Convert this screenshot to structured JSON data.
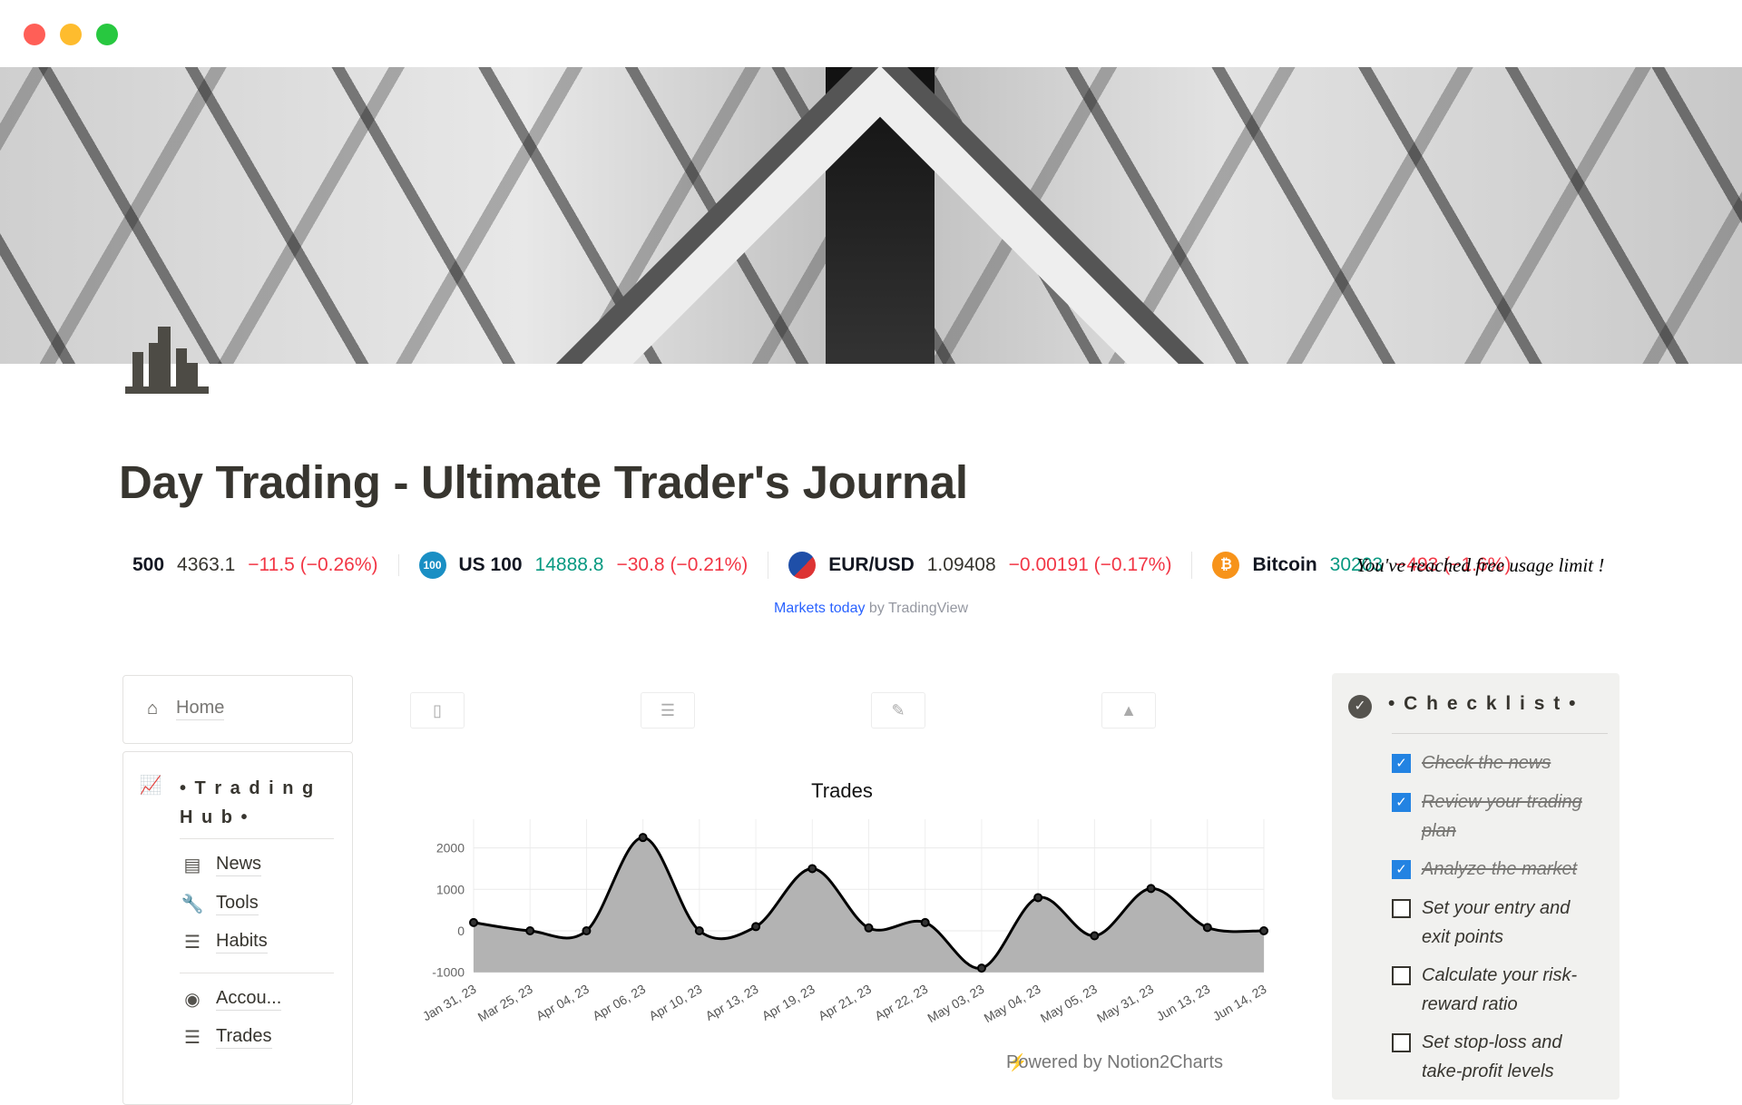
{
  "window": {
    "controls": {
      "close": "#ff5f57",
      "minimize": "#febc2e",
      "maximize": "#28c840"
    }
  },
  "page": {
    "title": "Day Trading - Ultimate Trader's Journal",
    "icon": "bar-chart-icon"
  },
  "ticker": {
    "items": [
      {
        "name": "500",
        "price": "4363.1",
        "change": "−11.5 (−0.26%)",
        "price_color": "#131722",
        "change_color": "#f23645"
      },
      {
        "name": "US 100",
        "icon_text": "100",
        "price": "14888.8",
        "change": "−30.8 (−0.21%)",
        "price_color": "#089981",
        "change_color": "#f23645"
      },
      {
        "name": "EUR/USD",
        "price": "1.09408",
        "change": "−0.00191 (−0.17%)",
        "price_color": "#131722",
        "change_color": "#f23645"
      },
      {
        "name": "Bitcoin",
        "icon_text": "₿",
        "price": "30203",
        "change": "−493 (−1.6%)",
        "price_color": "#089981",
        "change_color": "#f23645"
      }
    ],
    "limit_message": "You've reached free usage limit !",
    "credit_link": "Markets today",
    "credit_suffix": " by TradingView"
  },
  "sidebar": {
    "home": "Home",
    "hub_title": "• T r a d i n g  H u b •",
    "items": [
      {
        "label": "News",
        "icon": "newspaper-icon"
      },
      {
        "label": "Tools",
        "icon": "wrench-icon"
      },
      {
        "label": "Habits",
        "icon": "checklist-icon"
      }
    ],
    "items2": [
      {
        "label": "Accou...",
        "icon": "user-circle-icon"
      },
      {
        "label": "Trades",
        "icon": "gantt-icon"
      }
    ]
  },
  "toolbar": {
    "buttons": [
      "notes-icon",
      "checklist-icon",
      "edit-icon",
      "area-chart-icon"
    ]
  },
  "chart_data": {
    "type": "area",
    "title": "Trades",
    "categories": [
      "Jan 31, 23",
      "Mar 25, 23",
      "Apr 04, 23",
      "Apr 06, 23",
      "Apr 10, 23",
      "Apr 13, 23",
      "Apr 19, 23",
      "Apr 21, 23",
      "Apr 22, 23",
      "May 03, 23",
      "May 04, 23",
      "May 05, 23",
      "May 31, 23",
      "Jun 13, 23",
      "Jun 14, 23"
    ],
    "values": [
      200,
      0,
      0,
      2250,
      0,
      100,
      1500,
      70,
      200,
      -900,
      800,
      -120,
      1020,
      80,
      0
    ],
    "ylim": [
      -1000,
      2400
    ],
    "yticks": [
      2000,
      1000,
      0,
      -1000
    ],
    "grid": true,
    "fill_color": "#b3b3b3",
    "line_color": "#000000",
    "footer": "Powered by Notion2Charts"
  },
  "checklist": {
    "title": "• C h e c k l i s t •",
    "items": [
      {
        "text": "Check the news",
        "checked": true
      },
      {
        "text": "Review your trading plan",
        "checked": true
      },
      {
        "text": "Analyze the market",
        "checked": true
      },
      {
        "text": "Set your entry and exit points",
        "checked": false
      },
      {
        "text": "Calculate your risk-reward ratio",
        "checked": false
      },
      {
        "text": "Set stop-loss and take-profit levels",
        "checked": false
      }
    ]
  }
}
